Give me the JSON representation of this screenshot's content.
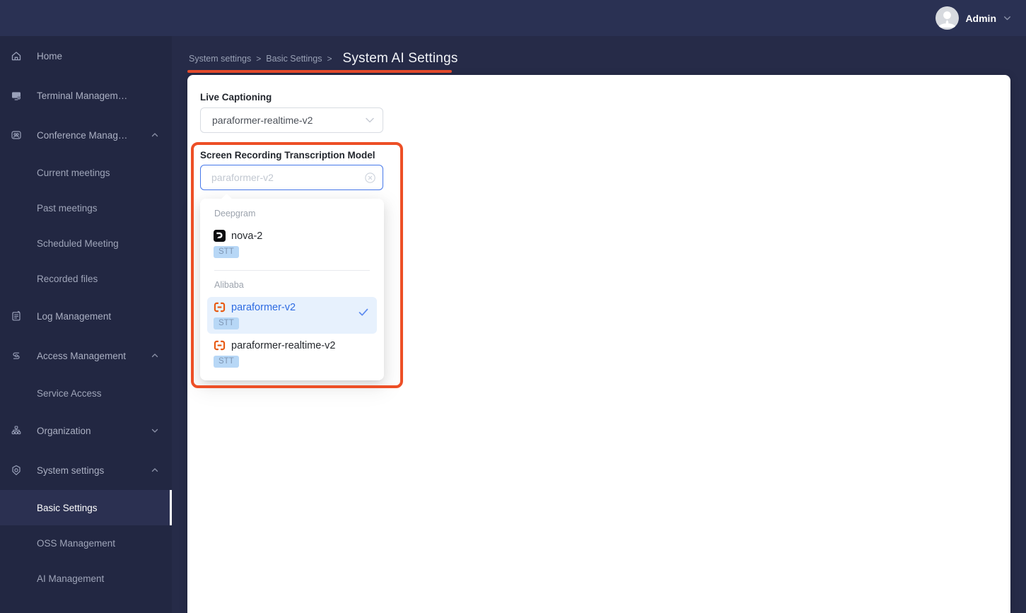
{
  "header": {
    "user_label": "Admin"
  },
  "sidebar": {
    "items": [
      "Home",
      "Terminal Managem…",
      "Conference Manag…",
      "Current meetings",
      "Past meetings",
      "Scheduled Meeting",
      "Recorded files",
      "Log Management",
      "Access Management",
      "Service Access",
      "Organization",
      "System settings",
      "Basic Settings",
      "OSS Management",
      "AI Management"
    ]
  },
  "breadcrumb": {
    "crumbs": [
      "System settings",
      "Basic Settings"
    ],
    "separator": ">",
    "current": "System AI Settings"
  },
  "annotation": {
    "underline_color": "#e2492b",
    "box_color": "#ed4f26"
  },
  "settings": {
    "live_captioning_label": "Live Captioning",
    "live_captioning_value": "paraformer-realtime-v2",
    "transcription_label": "Screen Recording Transcription Model",
    "search_placeholder": "paraformer-v2"
  },
  "dropdown": {
    "groups": [
      {
        "name": "Deepgram",
        "options": [
          {
            "label": "nova-2",
            "tag": "STT",
            "icon": "deepgram-logo-icon",
            "selected": false
          }
        ]
      },
      {
        "name": "Alibaba",
        "options": [
          {
            "label": "paraformer-v2",
            "tag": "STT",
            "icon": "alibaba-logo-icon",
            "selected": true
          },
          {
            "label": "paraformer-realtime-v2",
            "tag": "STT",
            "icon": "alibaba-logo-icon",
            "selected": false
          }
        ]
      }
    ]
  },
  "colors": {
    "header_bg": "#2a3153",
    "sidebar_bg": "#222742",
    "content_bg": "#262b48",
    "active_nav_bg": "#2b3051",
    "input_focus_border": "#4678ea",
    "selected_option_bg": "#e7f1fd",
    "selected_option_text": "#2f6ce2",
    "badge_bg": "#b7d7f6",
    "badge_text": "#7e96b4",
    "check_color": "#5e8cf0"
  }
}
